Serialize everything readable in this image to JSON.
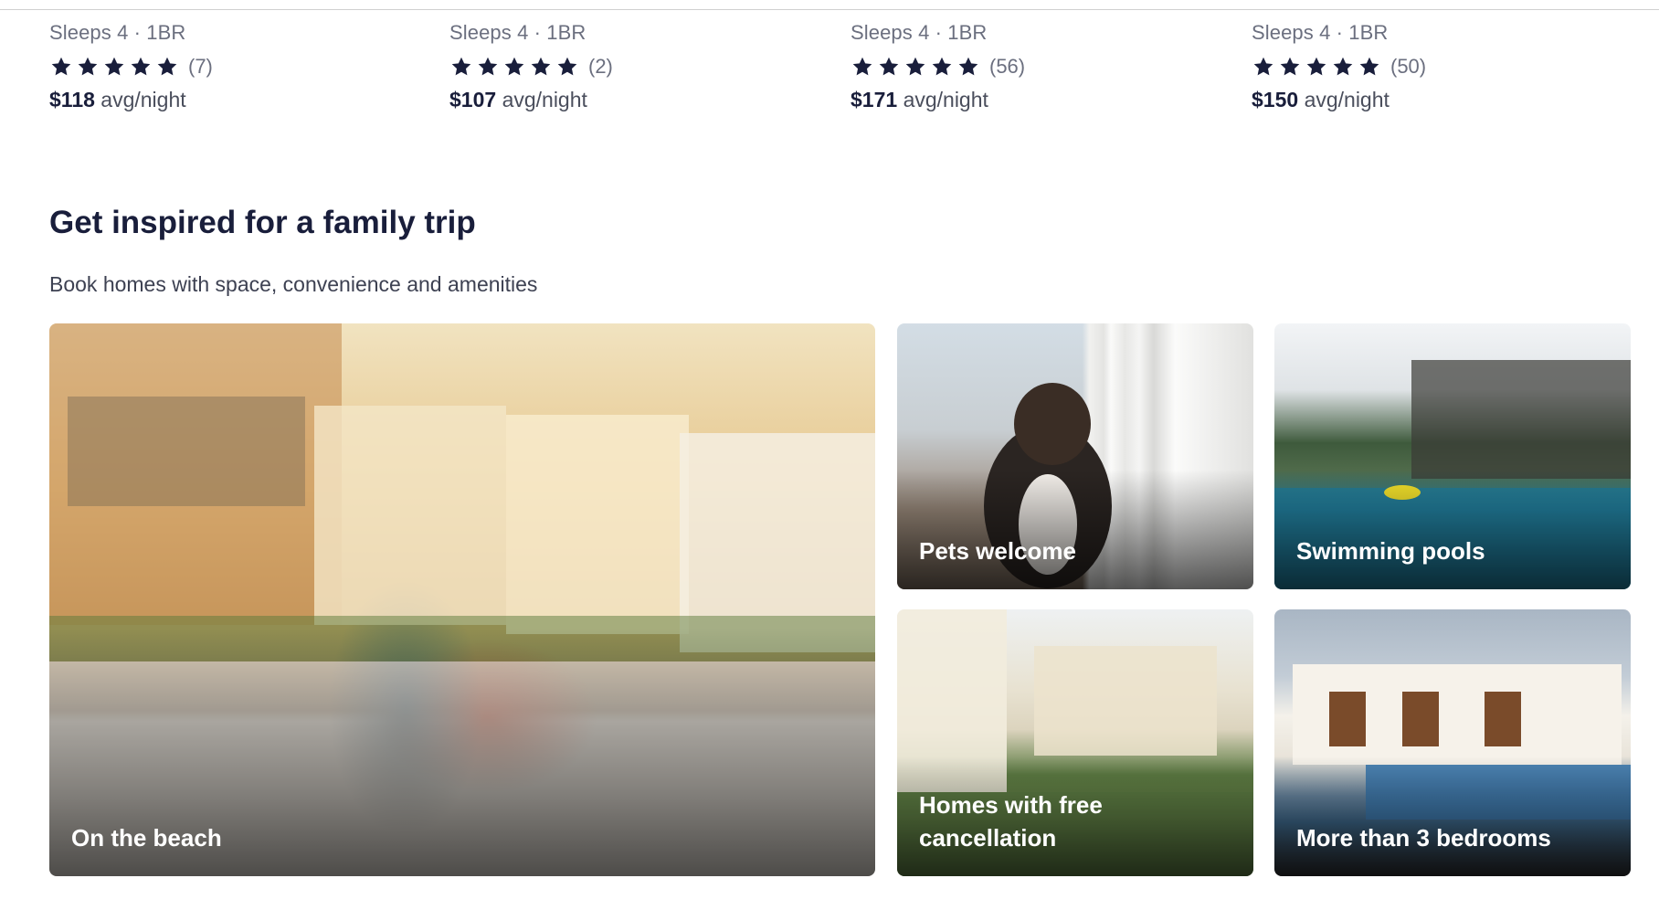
{
  "listings": [
    {
      "meta": "Sleeps 4 · 1BR",
      "rating_stars": 5,
      "review_count": "(7)",
      "price": "$118",
      "price_unit": "avg/night"
    },
    {
      "meta": "Sleeps 4 · 1BR",
      "rating_stars": 5,
      "review_count": "(2)",
      "price": "$107",
      "price_unit": "avg/night"
    },
    {
      "meta": "Sleeps 4 · 1BR",
      "rating_stars": 5,
      "review_count": "(56)",
      "price": "$171",
      "price_unit": "avg/night"
    },
    {
      "meta": "Sleeps 4 · 1BR",
      "rating_stars": 5,
      "review_count": "(50)",
      "price": "$150",
      "price_unit": "avg/night"
    }
  ],
  "section": {
    "title": "Get inspired for a family trip",
    "subtitle": "Book homes with space, convenience and amenities"
  },
  "cards": {
    "beach": "On the beach",
    "pets": "Pets welcome",
    "pools": "Swimming pools",
    "cancellation": "Homes with free cancellation",
    "bedrooms": "More than 3 bedrooms"
  },
  "colors": {
    "text": "#191e3b",
    "muted": "#6b6f7f",
    "link": "#1668e3"
  },
  "icons": {
    "star": "star-icon"
  }
}
